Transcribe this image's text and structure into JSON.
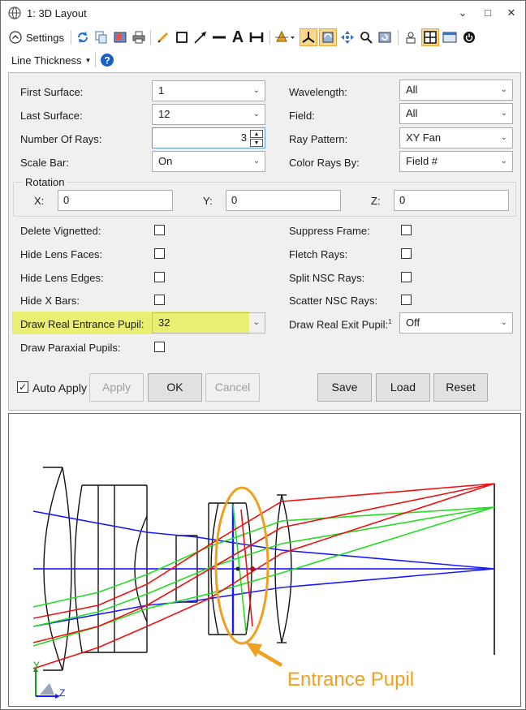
{
  "window": {
    "title": "1: 3D Layout",
    "controls": [
      "⌄",
      "□",
      "✕"
    ]
  },
  "toolbar": {
    "settings_label": "Settings",
    "line_thickness_label": "Line Thickness",
    "text_tool_glyph": "A"
  },
  "settings": {
    "first_surface": {
      "label": "First Surface:",
      "value": "1"
    },
    "last_surface": {
      "label": "Last Surface:",
      "value": "12"
    },
    "number_of_rays": {
      "label": "Number Of Rays:",
      "value": "3"
    },
    "scale_bar": {
      "label": "Scale Bar:",
      "value": "On"
    },
    "wavelength": {
      "label": "Wavelength:",
      "value": "All"
    },
    "field": {
      "label": "Field:",
      "value": "All"
    },
    "ray_pattern": {
      "label": "Ray Pattern:",
      "value": "XY Fan"
    },
    "color_rays_by": {
      "label": "Color Rays By:",
      "value": "Field #"
    },
    "rotation": {
      "legend": "Rotation",
      "x": {
        "label": "X:",
        "value": "0"
      },
      "y": {
        "label": "Y:",
        "value": "0"
      },
      "z": {
        "label": "Z:",
        "value": "0"
      }
    },
    "delete_vignetted": {
      "label": "Delete Vignetted:",
      "checked": false
    },
    "hide_lens_faces": {
      "label": "Hide Lens Faces:",
      "checked": false
    },
    "hide_lens_edges": {
      "label": "Hide Lens Edges:",
      "checked": false
    },
    "hide_x_bars": {
      "label": "Hide X Bars:",
      "checked": false
    },
    "draw_real_entrance_pupil": {
      "label": "Draw Real Entrance Pupil:",
      "value": "32"
    },
    "draw_paraxial_pupils": {
      "label": "Draw Paraxial Pupils:",
      "checked": false
    },
    "suppress_frame": {
      "label": "Suppress Frame:",
      "checked": false
    },
    "fletch_rays": {
      "label": "Fletch Rays:",
      "checked": false
    },
    "split_nsc_rays": {
      "label": "Split NSC Rays:",
      "checked": false
    },
    "scatter_nsc_rays": {
      "label": "Scatter NSC Rays:",
      "checked": false
    },
    "draw_real_exit_pupil": {
      "label": "Draw Real Exit Pupil:",
      "footnote": "1",
      "value": "Off"
    }
  },
  "buttons": {
    "auto_apply": {
      "label": "Auto Apply",
      "checked": true
    },
    "apply": "Apply",
    "ok": "OK",
    "cancel": "Cancel",
    "save": "Save",
    "load": "Load",
    "reset": "Reset"
  },
  "plot": {
    "annotation": "Entrance Pupil",
    "axis_y": "Y",
    "axis_z": "Z",
    "colors": {
      "blue_field": "#1a1aff",
      "green_field": "#22dd22",
      "red_field": "#ee1111",
      "annotation": "#f0a020",
      "highlight": "#e8ef72"
    }
  }
}
